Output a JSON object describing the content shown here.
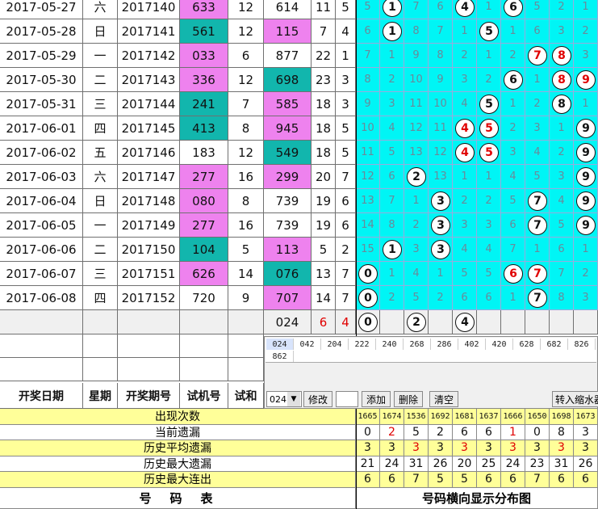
{
  "rows": [
    {
      "date": "2017-05-27",
      "week": "六",
      "issue": "2017140",
      "test": "633",
      "sum": "12",
      "draw": "614",
      "s1": "11",
      "s2": "5",
      "test_bg": "pink",
      "draw_bg": "white"
    },
    {
      "date": "2017-05-28",
      "week": "日",
      "issue": "2017141",
      "test": "561",
      "sum": "12",
      "draw": "115",
      "s1": "7",
      "s2": "4",
      "test_bg": "teal",
      "draw_bg": "pink"
    },
    {
      "date": "2017-05-29",
      "week": "一",
      "issue": "2017142",
      "test": "033",
      "sum": "6",
      "draw": "877",
      "s1": "22",
      "s2": "1",
      "test_bg": "pink",
      "draw_bg": "white"
    },
    {
      "date": "2017-05-30",
      "week": "二",
      "issue": "2017143",
      "test": "336",
      "sum": "12",
      "draw": "698",
      "s1": "23",
      "s2": "3",
      "test_bg": "pink",
      "draw_bg": "teal"
    },
    {
      "date": "2017-05-31",
      "week": "三",
      "issue": "2017144",
      "test": "241",
      "sum": "7",
      "draw": "585",
      "s1": "18",
      "s2": "3",
      "test_bg": "teal",
      "draw_bg": "pink"
    },
    {
      "date": "2017-06-01",
      "week": "四",
      "issue": "2017145",
      "test": "413",
      "sum": "8",
      "draw": "945",
      "s1": "18",
      "s2": "5",
      "test_bg": "teal",
      "draw_bg": "pink"
    },
    {
      "date": "2017-06-02",
      "week": "五",
      "issue": "2017146",
      "test": "183",
      "sum": "12",
      "draw": "549",
      "s1": "18",
      "s2": "5",
      "test_bg": "white",
      "draw_bg": "teal"
    },
    {
      "date": "2017-06-03",
      "week": "六",
      "issue": "2017147",
      "test": "277",
      "sum": "16",
      "draw": "299",
      "s1": "20",
      "s2": "7",
      "test_bg": "pink",
      "draw_bg": "pink"
    },
    {
      "date": "2017-06-04",
      "week": "日",
      "issue": "2017148",
      "test": "080",
      "sum": "8",
      "draw": "739",
      "s1": "19",
      "s2": "6",
      "test_bg": "pink",
      "draw_bg": "white"
    },
    {
      "date": "2017-06-05",
      "week": "一",
      "issue": "2017149",
      "test": "277",
      "sum": "16",
      "draw": "739",
      "s1": "19",
      "s2": "6",
      "test_bg": "pink",
      "draw_bg": "white"
    },
    {
      "date": "2017-06-06",
      "week": "二",
      "issue": "2017150",
      "test": "104",
      "sum": "5",
      "draw": "113",
      "s1": "5",
      "s2": "2",
      "test_bg": "teal",
      "draw_bg": "pink"
    },
    {
      "date": "2017-06-07",
      "week": "三",
      "issue": "2017151",
      "test": "626",
      "sum": "14",
      "draw": "076",
      "s1": "13",
      "s2": "7",
      "test_bg": "pink",
      "draw_bg": "teal"
    },
    {
      "date": "2017-06-08",
      "week": "四",
      "issue": "2017152",
      "test": "720",
      "sum": "9",
      "draw": "707",
      "s1": "14",
      "s2": "7",
      "test_bg": "white",
      "draw_bg": "pink"
    }
  ],
  "dist": [
    [
      "5",
      "@1",
      "7",
      "6",
      "@4",
      "1",
      "@6",
      "5",
      "2",
      "1"
    ],
    [
      "6",
      "@1",
      "8",
      "7",
      "1",
      "@5",
      "1",
      "6",
      "3",
      "2"
    ],
    [
      "7",
      "1",
      "9",
      "8",
      "2",
      "1",
      "2",
      "!7",
      "!8",
      "3"
    ],
    [
      "8",
      "2",
      "10",
      "9",
      "3",
      "2",
      "@6",
      "1",
      "!8",
      "!9"
    ],
    [
      "9",
      "3",
      "11",
      "10",
      "4",
      "@5",
      "1",
      "2",
      "@8",
      "1"
    ],
    [
      "10",
      "4",
      "12",
      "11",
      "!4",
      "!5",
      "2",
      "3",
      "1",
      "@9"
    ],
    [
      "11",
      "5",
      "13",
      "12",
      "!4",
      "!5",
      "3",
      "4",
      "2",
      "@9"
    ],
    [
      "12",
      "6",
      "@2",
      "13",
      "1",
      "1",
      "4",
      "5",
      "3",
      "@9"
    ],
    [
      "13",
      "7",
      "1",
      "@3",
      "2",
      "2",
      "5",
      "@7",
      "4",
      "@9"
    ],
    [
      "14",
      "8",
      "2",
      "@3",
      "3",
      "3",
      "6",
      "@7",
      "5",
      "@9"
    ],
    [
      "15",
      "@1",
      "3",
      "@3",
      "4",
      "4",
      "7",
      "1",
      "6",
      "1"
    ],
    [
      "@0",
      "1",
      "4",
      "1",
      "5",
      "5",
      "!6",
      "!7",
      "7",
      "2"
    ],
    [
      "@0",
      "2",
      "5",
      "2",
      "6",
      "6",
      "1",
      "@7",
      "8",
      "3"
    ]
  ],
  "prediction": {
    "number": "024",
    "s1": "6",
    "s2": "4",
    "balls": [
      "@0",
      "",
      "@2",
      "",
      "@4",
      "",
      "",
      "",
      "",
      ""
    ]
  },
  "headers": {
    "date": "开奖日期",
    "week": "星期",
    "issue": "开奖期号",
    "test": "试机号",
    "sum": "试和"
  },
  "panel": {
    "row1": [
      "024",
      "042",
      "204",
      "222",
      "240",
      "268",
      "286",
      "402",
      "420",
      "628",
      "682",
      "826"
    ],
    "row2": [
      "862"
    ],
    "select_value": "024",
    "btn_modify": "修改",
    "btn_add": "添加",
    "btn_delete": "删除",
    "btn_clear": "清空",
    "btn_shrink": "转入缩水器"
  },
  "stats": {
    "labels": [
      "出现次数",
      "当前遗漏",
      "历史平均遗漏",
      "历史最大遗漏",
      "历史最大连出"
    ],
    "counts": [
      "1665",
      "1674",
      "1536",
      "1692",
      "1681",
      "1637",
      "1666",
      "1650",
      "1698",
      "1673"
    ],
    "current_miss": [
      "0",
      "2",
      "5",
      "2",
      "6",
      "6",
      "1",
      "0",
      "8",
      "3"
    ],
    "avg_miss": [
      "3",
      "3",
      "3",
      "3",
      "3",
      "3",
      "3",
      "3",
      "3",
      "3"
    ],
    "max_miss": [
      "21",
      "24",
      "31",
      "26",
      "20",
      "25",
      "24",
      "23",
      "31",
      "26"
    ],
    "max_streak": [
      "6",
      "6",
      "7",
      "5",
      "5",
      "6",
      "6",
      "7",
      "6",
      "6"
    ]
  },
  "footer": {
    "left": "号　码　表",
    "right": "号码横向显示分布图"
  },
  "colors": {
    "cyan": "#00f5f5",
    "pink": "#ee82ee",
    "teal": "#12b6ad",
    "yellow": "#ffff99",
    "red": "#e00000"
  }
}
